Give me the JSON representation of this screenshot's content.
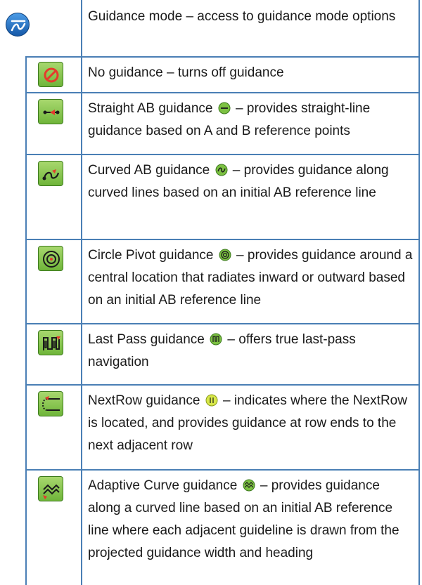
{
  "rows": [
    {
      "icon": "guidance-mode-icon",
      "title": "Guidance mode",
      "desc": "– access to guidance mode options"
    },
    {
      "icon": "no-guidance-icon",
      "title": "No guidance",
      "desc": "– turns off guidance"
    },
    {
      "icon": "straight-ab-icon",
      "title": "Straight AB guidance",
      "desc": "– provides straight-line guidance based on A and B reference points",
      "inline_icon": "straight-ab-small-icon"
    },
    {
      "icon": "curved-ab-icon",
      "title": "Curved AB guidance",
      "desc": "– provides guidance along curved lines based on an initial AB reference line",
      "inline_icon": "curved-ab-small-icon"
    },
    {
      "icon": "circle-pivot-icon",
      "title": "Circle Pivot guidance",
      "desc": "– provides guidance around a central location that radiates inward or outward based on an initial AB reference line",
      "inline_icon": "circle-pivot-small-icon"
    },
    {
      "icon": "last-pass-icon",
      "title": "Last Pass guidance",
      "desc": "– offers true last-pass navigation",
      "inline_icon": "last-pass-small-icon"
    },
    {
      "icon": "nextrow-icon",
      "title": "NextRow guidance",
      "desc": "– indicates where the NextRow is located, and provides guidance at row ends to the next adjacent row",
      "inline_icon": "nextrow-small-icon"
    },
    {
      "icon": "adaptive-curve-icon",
      "title": "Adaptive Curve guidance",
      "desc": "– provides guidance along a curved line based on an initial AB reference line where each adjacent guideline is drawn from the projected guidance width and heading",
      "inline_icon": "adaptive-curve-small-icon"
    }
  ],
  "colors": {
    "border": "#4a7fb5",
    "button_green": "#7cc142",
    "mode_blue": "#1e6fc0",
    "accent_red": "#e53b2c"
  }
}
